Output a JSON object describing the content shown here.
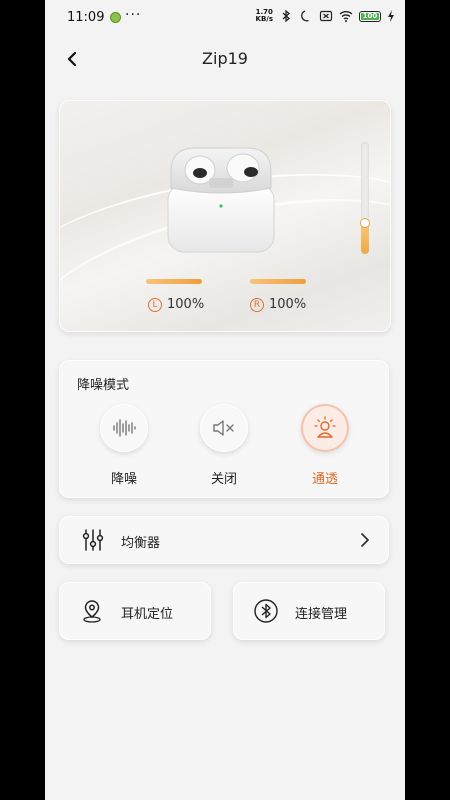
{
  "status_bar": {
    "time": "11:09",
    "net_speed_value": "1.70",
    "net_speed_unit": "KB/s",
    "battery": "100"
  },
  "header": {
    "title": "Zip19"
  },
  "device": {
    "volume_level_pct": 28,
    "left": {
      "letter": "L",
      "battery": "100%"
    },
    "right": {
      "letter": "R",
      "battery": "100%"
    }
  },
  "anc": {
    "title": "降噪模式",
    "modes": [
      {
        "label": "降噪",
        "icon": "soundwave-icon",
        "active": false
      },
      {
        "label": "关闭",
        "icon": "speaker-mute-icon",
        "active": false
      },
      {
        "label": "通透",
        "icon": "transparency-icon",
        "active": true
      }
    ]
  },
  "equalizer": {
    "label": "均衡器",
    "icon": "equalizer-sliders-icon"
  },
  "tiles": [
    {
      "label": "耳机定位",
      "icon": "location-pin-icon"
    },
    {
      "label": "连接管理",
      "icon": "bluetooth-icon"
    }
  ],
  "colors": {
    "accent": "#e06a2a",
    "battery_bar": "#ef9e3d",
    "background": "#f3f3f3"
  }
}
